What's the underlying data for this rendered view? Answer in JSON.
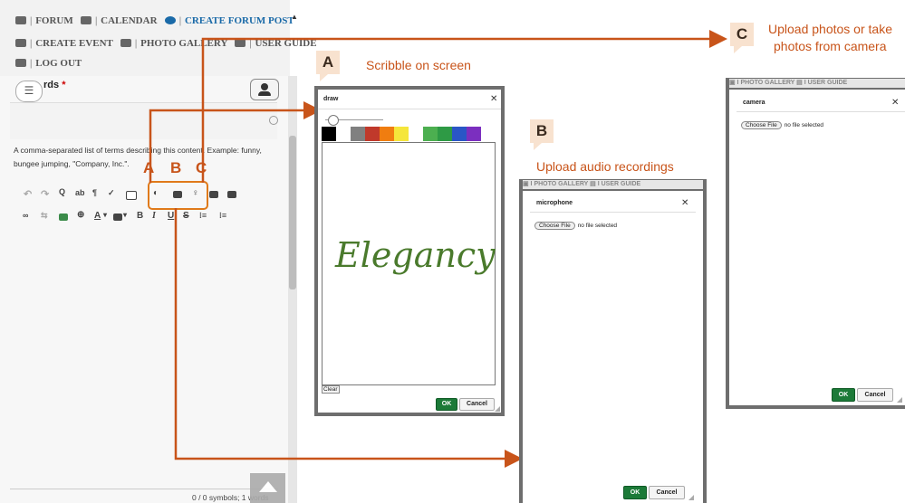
{
  "nav": {
    "row1": {
      "forum": "FORUM",
      "calendar": "CALENDAR",
      "create_forum_post": "CREATE FORUM POST"
    },
    "row2": {
      "create_event": "CREATE EVENT",
      "photo_gallery": "PHOTO GALLERY",
      "user_guide": "USER GUIDE"
    },
    "row3": {
      "log_out": "LOG OUT"
    },
    "separator": "|"
  },
  "editor": {
    "field_label": "rds",
    "required_mark": "*",
    "hamburger": "☰",
    "help_text": "A comma-separated list of terms describing this content. Example: funny, bungee jumping, \"Company, Inc.\".",
    "counter": "0 / 0 symbols; 1 words",
    "mini_labels": [
      "A",
      "B",
      "C"
    ]
  },
  "toolbar": {
    "row1": [
      "↶",
      "↷",
      "🔍",
      "ᵇ",
      "¶",
      "✎",
      "▣",
      "🎨",
      "📷",
      "🎤",
      "▤",
      "▶"
    ],
    "row2": [
      "∞",
      "⇆",
      "▦",
      "⊕",
      "A",
      "▣",
      "B",
      "I",
      "U",
      "S",
      "⁝≡",
      "⁝≡"
    ]
  },
  "callouts": {
    "A": {
      "letter": "A",
      "text": "Scribble on screen"
    },
    "B": {
      "letter": "B",
      "text": "Upload audio recordings"
    },
    "C": {
      "letter": "C",
      "text_line1": "Upload photos or take",
      "text_line2": "photos from camera"
    }
  },
  "draw_dialog": {
    "title": "draw",
    "close": "✕",
    "palette": [
      "#000000",
      "#ffffff",
      "#808080",
      "#c0392b",
      "#f07d10",
      "#f5e63b",
      "#ffffff",
      "#4caf50",
      "#2e9a45",
      "#2a56c6",
      "#7b2fbf"
    ],
    "sample_text": "Elegancy",
    "clear": "Clear",
    "ok": "OK",
    "cancel": "Cancel"
  },
  "mic_dialog": {
    "header_ghost": "▣ I PHOTO GALLERY  ▤ I USER GUIDE",
    "title": "microphone",
    "close": "✕",
    "choose_file": "Choose File",
    "no_file": "no file selected",
    "ok": "OK",
    "cancel": "Cancel"
  },
  "camera_dialog": {
    "header_ghost": "▣ I PHOTO GALLERY  ▤ I USER GUIDE",
    "title": "camera",
    "close": "✕",
    "choose_file": "Choose File",
    "no_file": "no file selected",
    "ok": "OK",
    "cancel": "Cancel"
  },
  "colors": {
    "accent_orange": "#c8541a",
    "ok_green": "#1c7a38",
    "nav_active": "#1a6aa8",
    "scribble_green": "#4a7a2c"
  }
}
